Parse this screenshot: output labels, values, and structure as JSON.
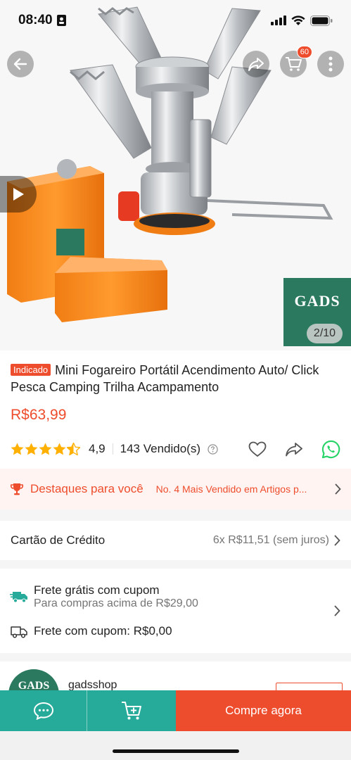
{
  "status_bar": {
    "time": "08:40"
  },
  "nav": {
    "cart_count": "60"
  },
  "gallery": {
    "shop_logo_text": "GADS",
    "counter": "2/10"
  },
  "product": {
    "badge": "Indicado",
    "title": "Mini Fogareiro Portátil Acendimento Auto/ Click Pesca Camping Trilha Acampamento",
    "price": "R$63,99",
    "rating": "4,9",
    "sold": "143 Vendido(s)"
  },
  "highlights": {
    "title": "Destaques para você",
    "text": "No. 4 Mais Vendido em Artigos p..."
  },
  "payment": {
    "label": "Cartão de Crédito",
    "value": "6x R$11,51 (sem juros)"
  },
  "shipping": {
    "free_title": "Frete grátis com cupom",
    "free_subtitle": "Para compras acima de R$29,00",
    "coupon_line": "Frete com cupom: R$0,00"
  },
  "shop": {
    "avatar_text": "GADS",
    "name": "gadsshop"
  },
  "bottom_bar": {
    "buy_label": "Compre agora"
  },
  "colors": {
    "accent": "#ee4d2d",
    "teal": "#26aa99",
    "whatsapp": "#25d366",
    "star": "#ffb000",
    "brand_green": "#2b7a5f"
  },
  "icons": [
    "back-arrow-icon",
    "share-icon",
    "cart-icon",
    "more-icon",
    "play-icon",
    "star-icon",
    "help-icon",
    "heart-icon",
    "whatsapp-icon",
    "trophy-icon",
    "chevron-right-icon",
    "truck-icon",
    "chat-icon",
    "add-to-cart-icon"
  ]
}
